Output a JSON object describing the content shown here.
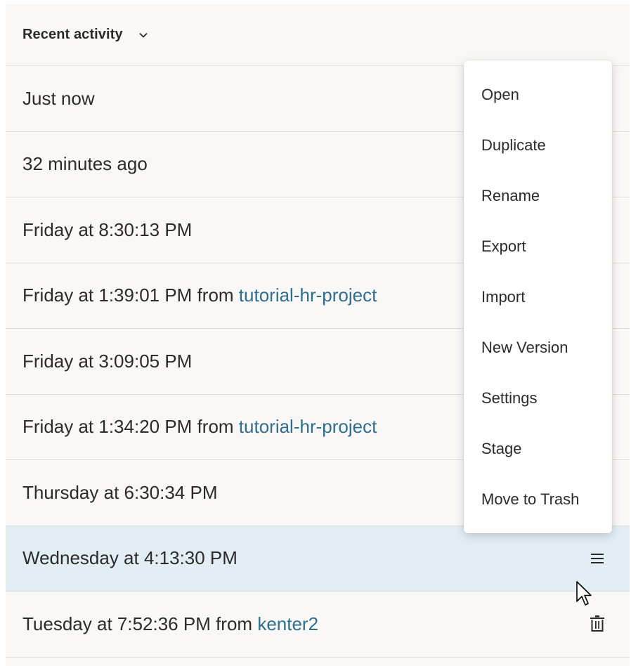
{
  "header": {
    "title": "Recent activity"
  },
  "rows": [
    {
      "text": "Just now",
      "source_prefix": "",
      "source": ""
    },
    {
      "text": "32 minutes ago",
      "source_prefix": "",
      "source": ""
    },
    {
      "text": "Friday at 8:30:13 PM",
      "source_prefix": "",
      "source": ""
    },
    {
      "text": "Friday at 1:39:01 PM",
      "source_prefix": " from ",
      "source": "tutorial-hr-project"
    },
    {
      "text": "Friday at 3:09:05 PM",
      "source_prefix": "",
      "source": ""
    },
    {
      "text": "Friday at 1:34:20 PM",
      "source_prefix": " from ",
      "source": "tutorial-hr-project"
    },
    {
      "text": "Thursday at 6:30:34 PM",
      "source_prefix": "",
      "source": ""
    },
    {
      "text": "Wednesday at 4:13:30 PM",
      "source_prefix": "",
      "source": ""
    },
    {
      "text": "Tuesday at 7:52:36 PM",
      "source_prefix": " from ",
      "source": "kenter2"
    }
  ],
  "selected_row_index": 7,
  "icons": {
    "header_toggle": "chevron-down-icon",
    "selected_row_action": "hamburger-menu-icon",
    "last_row_action": "trash-icon"
  },
  "context_menu": {
    "items": [
      "Open",
      "Duplicate",
      "Rename",
      "Export",
      "Import",
      "New Version",
      "Settings",
      "Stage",
      "Move to Trash"
    ]
  },
  "colors": {
    "panel_background": "#f9f8f7",
    "selected_row": "#e3eef4",
    "link": "#2e6e8e",
    "text": "#2b2b2b"
  }
}
